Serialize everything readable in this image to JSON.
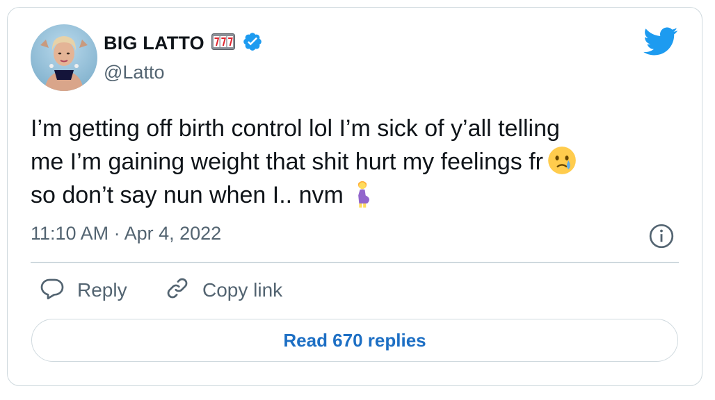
{
  "author": {
    "display_name": "BIG LATTO",
    "handle": "@Latto",
    "verified": true,
    "name_emoji": "slot-machine-icon",
    "brand_color": "#1d9bf0"
  },
  "tweet": {
    "line1": "I’m getting off birth control lol I’m sick of y’all telling",
    "line2": "me I’m gaining weight that shit hurt my feelings fr",
    "line3": "so don’t say nun when I.. nvm",
    "emoji_1": "crying-face-icon",
    "emoji_2": "pregnant-woman-icon"
  },
  "meta": {
    "timestamp": "11:10 AM · Apr 4, 2022"
  },
  "actions": {
    "reply_label": "Reply",
    "copy_link_label": "Copy link"
  },
  "read_replies": {
    "label": "Read 670 replies",
    "color": "#1d6fc4"
  }
}
